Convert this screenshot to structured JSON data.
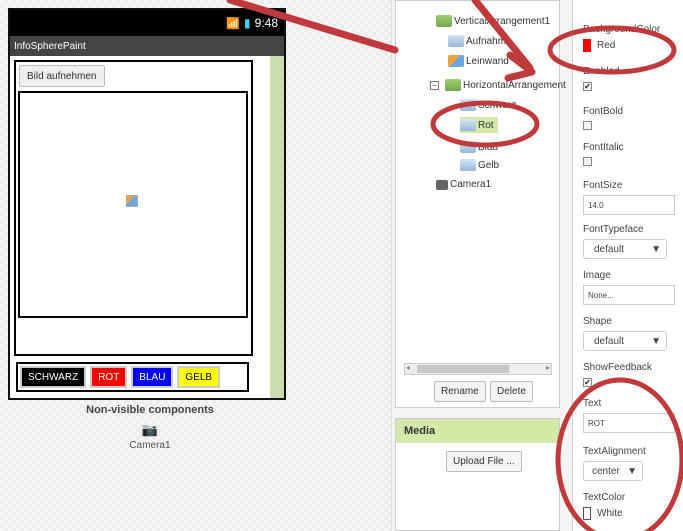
{
  "phone": {
    "time": "9:48",
    "app_title": "InfoSpherePaint",
    "photo_button": "Bild aufnehmen",
    "color_buttons": [
      "SCHWARZ",
      "ROT",
      "BLAU",
      "GELB"
    ]
  },
  "nonvisible": {
    "title": "Non-visible components",
    "camera_label": "Camera1"
  },
  "tree": {
    "nodes": [
      {
        "label": "VerticalArrangement1",
        "icon": "arrangement-icon"
      },
      {
        "label": "Aufnahme",
        "icon": "button-icon"
      },
      {
        "label": "Leinwand",
        "icon": "canvas-icon"
      },
      {
        "label": "HorizontalArrangement",
        "icon": "arrangement-icon"
      },
      {
        "label": "Schwarz",
        "icon": "button-icon"
      },
      {
        "label": "Rot",
        "icon": "button-icon"
      },
      {
        "label": "Blau",
        "icon": "button-icon"
      },
      {
        "label": "Gelb",
        "icon": "button-icon"
      },
      {
        "label": "Camera1",
        "icon": "camera-icon"
      }
    ],
    "rename": "Rename",
    "delete": "Delete"
  },
  "media": {
    "title": "Media",
    "upload": "Upload File ..."
  },
  "properties": {
    "background_color": {
      "label": "BackgroundColor",
      "value": "Red",
      "color": "#ff0000"
    },
    "enabled": {
      "label": "Enabled",
      "checked": true
    },
    "font_bold": {
      "label": "FontBold",
      "checked": false
    },
    "font_italic": {
      "label": "FontItalic",
      "checked": false
    },
    "font_size": {
      "label": "FontSize",
      "value": "14.0"
    },
    "font_typeface": {
      "label": "FontTypeface",
      "value": "default"
    },
    "image": {
      "label": "Image",
      "value": "None..."
    },
    "shape": {
      "label": "Shape",
      "value": "default"
    },
    "show_feedback": {
      "label": "ShowFeedback",
      "checked": true
    },
    "text": {
      "label": "Text",
      "value": "ROT"
    },
    "text_alignment": {
      "label": "TextAlignment",
      "value": "center"
    },
    "text_color": {
      "label": "TextColor",
      "value": "White",
      "color": "#ffffff"
    }
  },
  "annotation_color": "#c0393b"
}
